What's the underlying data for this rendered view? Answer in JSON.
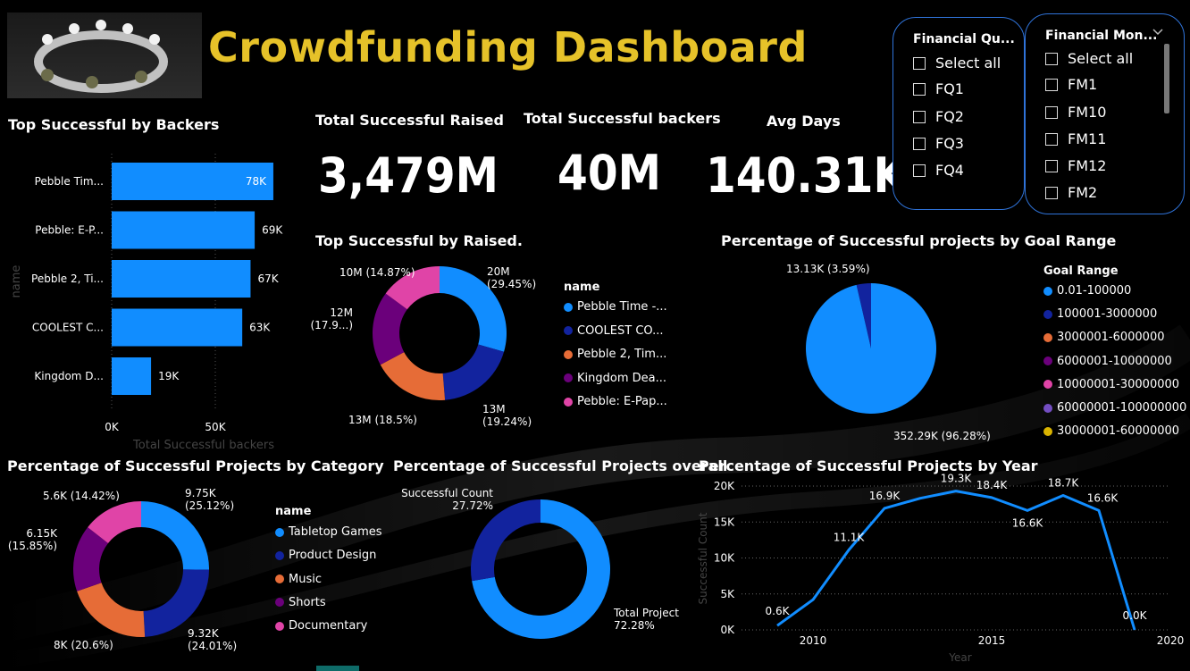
{
  "header": {
    "title": "Crowdfunding Dashboard"
  },
  "kpis": [
    {
      "label": "Total Successful Raised",
      "value": "3,479M"
    },
    {
      "label": "Total Successful backers",
      "value": "40M"
    },
    {
      "label": "Avg Days",
      "value": "140.31K"
    }
  ],
  "slicer_quarter": {
    "title": "Financial Qu...",
    "items": [
      "Select all",
      "FQ1",
      "FQ2",
      "FQ3",
      "FQ4"
    ]
  },
  "slicer_month": {
    "title": "Financial Mon...",
    "items": [
      "Select all",
      "FM1",
      "FM10",
      "FM11",
      "FM12",
      "FM2"
    ]
  },
  "colors": {
    "accent_blue": "#118DFF",
    "navy": "#12239E",
    "orange": "#E66C37",
    "purple": "#6B007B",
    "pink": "#E044A7",
    "violet": "#744EC2",
    "gold": "#D9B300",
    "title_gold": "#E6C229"
  },
  "chart_data": [
    {
      "type": "bar",
      "title": "Top Successful by Backers",
      "xlabel": "Total Successful backers",
      "ylabel": "name",
      "categories": [
        "Pebble Tim...",
        "Pebble: E-P...",
        "Pebble 2, Ti...",
        "COOLEST C...",
        "Kingdom D..."
      ],
      "values": [
        78,
        69,
        67,
        63,
        19
      ],
      "value_labels": [
        "78K",
        "69K",
        "67K",
        "63K",
        "19K"
      ],
      "x_ticks": [
        "0K",
        "50K"
      ],
      "xlim": [
        0,
        100
      ]
    },
    {
      "type": "pie",
      "donut": true,
      "title": "Top Successful by Raised.",
      "legend_title": "name",
      "legend": [
        "Pebble Time -...",
        "COOLEST CO...",
        "Pebble 2, Tim...",
        "Kingdom Dea...",
        "Pebble: E-Pap..."
      ],
      "values": [
        20,
        13,
        13,
        12,
        10
      ],
      "percents": [
        29.45,
        19.24,
        18.5,
        17.9,
        14.87
      ],
      "labels": [
        [
          "20M",
          "(29.45%)"
        ],
        [
          "13M",
          "(19.24%)"
        ],
        [
          "13M (18.5%)"
        ],
        [
          "12M",
          "(17.9...)"
        ],
        [
          "10M (14.87%)"
        ]
      ]
    },
    {
      "type": "pie",
      "title": "Percentage of Successful projects by Goal Range",
      "legend_title": "Goal Range",
      "legend": [
        "0.01-100000",
        "100001-3000000",
        "3000001-6000000",
        "6000001-10000000",
        "10000001-30000000",
        "60000001-100000000",
        "30000001-60000000"
      ],
      "values": [
        352.29,
        13.13
      ],
      "percents": [
        96.28,
        3.59
      ],
      "labels": [
        "352.29K (96.28%)",
        "13.13K (3.59%)"
      ]
    },
    {
      "type": "pie",
      "donut": true,
      "title": "Percentage of Successful Projects by Category",
      "legend_title": "name",
      "legend": [
        "Tabletop Games",
        "Product Design",
        "Music",
        "Shorts",
        "Documentary"
      ],
      "values": [
        9.75,
        9.32,
        8,
        6.15,
        5.6
      ],
      "percents": [
        25.12,
        24.01,
        20.6,
        15.85,
        14.42
      ],
      "labels": [
        [
          "9.75K",
          "(25.12%)"
        ],
        [
          "9.32K",
          "(24.01%)"
        ],
        [
          "8K (20.6%)"
        ],
        [
          "6.15K",
          "(15.85%)"
        ],
        [
          "5.6K (14.42%)"
        ]
      ]
    },
    {
      "type": "pie",
      "donut": true,
      "title": "Percentage of Successful Projects overall",
      "categories": [
        "Successful Count",
        "Total Project"
      ],
      "percents": [
        27.72,
        72.28
      ],
      "labels": [
        [
          "Successful Count",
          "27.72%"
        ],
        [
          "Total Project",
          "72.28%"
        ]
      ]
    },
    {
      "type": "line",
      "title": "Percentage of Successful Projects by Year",
      "xlabel": "Year",
      "ylabel": "Successful Count",
      "x": [
        2009,
        2010,
        2011,
        2012,
        2013,
        2014,
        2015,
        2016,
        2017,
        2018,
        2019
      ],
      "y": [
        0.6,
        4.2,
        11.1,
        16.9,
        18.3,
        19.3,
        18.4,
        16.6,
        18.7,
        16.6,
        0.0
      ],
      "point_labels": [
        "0.6K",
        null,
        "11.1K",
        "16.9K",
        null,
        "19.3K",
        "18.4K",
        "16.6K",
        "18.7K",
        "16.6K",
        "0.0K"
      ],
      "y_ticks": [
        "0K",
        "5K",
        "10K",
        "15K",
        "20K"
      ],
      "x_ticks": [
        "2010",
        "2015",
        "2020"
      ],
      "xlim": [
        2008,
        2020
      ],
      "ylim": [
        0,
        20
      ]
    }
  ]
}
